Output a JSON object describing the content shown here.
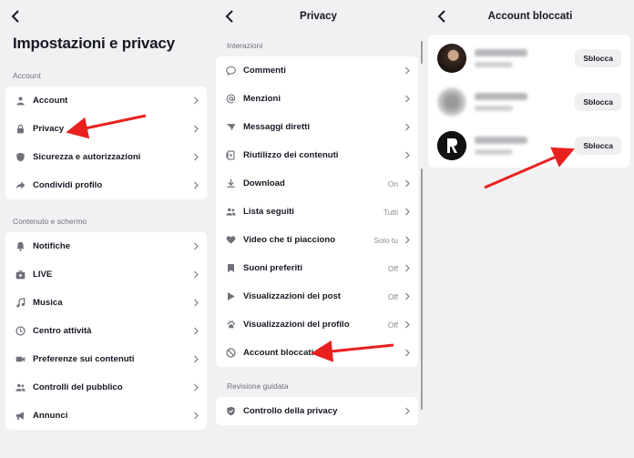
{
  "settings": {
    "title": "Impostazioni e privacy",
    "section_account": "Account",
    "account_items": [
      {
        "label": "Account",
        "icon": "person-icon"
      },
      {
        "label": "Privacy",
        "icon": "lock-icon"
      },
      {
        "label": "Sicurezza e autorizzazioni",
        "icon": "shield-icon"
      },
      {
        "label": "Condividi profilo",
        "icon": "share-icon"
      }
    ],
    "section_content": "Contenuto e schermo",
    "content_items": [
      {
        "label": "Notifiche",
        "icon": "bell-icon"
      },
      {
        "label": "LIVE",
        "icon": "live-icon"
      },
      {
        "label": "Musica",
        "icon": "music-icon"
      },
      {
        "label": "Centro attività",
        "icon": "clock-icon"
      },
      {
        "label": "Preferenze sui contenuti",
        "icon": "video-icon"
      },
      {
        "label": "Controlli del pubblico",
        "icon": "people-icon"
      },
      {
        "label": "Annunci",
        "icon": "megaphone-icon"
      }
    ]
  },
  "privacy": {
    "title": "Privacy",
    "section_interactions": "Interazioni",
    "items": [
      {
        "label": "Commenti",
        "value": "",
        "icon": "comment-icon"
      },
      {
        "label": "Menzioni",
        "value": "",
        "icon": "at-icon"
      },
      {
        "label": "Messaggi diretti",
        "value": "",
        "icon": "send-icon"
      },
      {
        "label": "Riutilizzo dei contenuti",
        "value": "",
        "icon": "reuse-icon"
      },
      {
        "label": "Download",
        "value": "On",
        "icon": "download-icon"
      },
      {
        "label": "Lista seguiti",
        "value": "Tutti",
        "icon": "people-icon"
      },
      {
        "label": "Video che ti piacciono",
        "value": "Solo tu",
        "icon": "heart-icon"
      },
      {
        "label": "Suoni preferiti",
        "value": "Off",
        "icon": "bookmark-icon"
      },
      {
        "label": "Visualizzazioni dei post",
        "value": "Off",
        "icon": "play-icon"
      },
      {
        "label": "Visualizzazioni del profilo",
        "value": "Off",
        "icon": "paw-icon"
      },
      {
        "label": "Account bloccati",
        "value": "",
        "icon": "block-icon"
      }
    ],
    "section_review": "Revisione guidata",
    "review_item": {
      "label": "Controllo della privacy",
      "icon": "shield-check-icon"
    }
  },
  "blocked": {
    "title": "Account bloccati",
    "unblock_label": "Sblocca",
    "accounts": [
      {
        "avatar_color": "#4a3a30"
      },
      {
        "avatar_color": "#7a7a7a"
      },
      {
        "avatar_color": "#111111"
      }
    ]
  },
  "colors": {
    "arrow": "#e8211f",
    "text": "#161823",
    "muted": "#6f7079"
  }
}
